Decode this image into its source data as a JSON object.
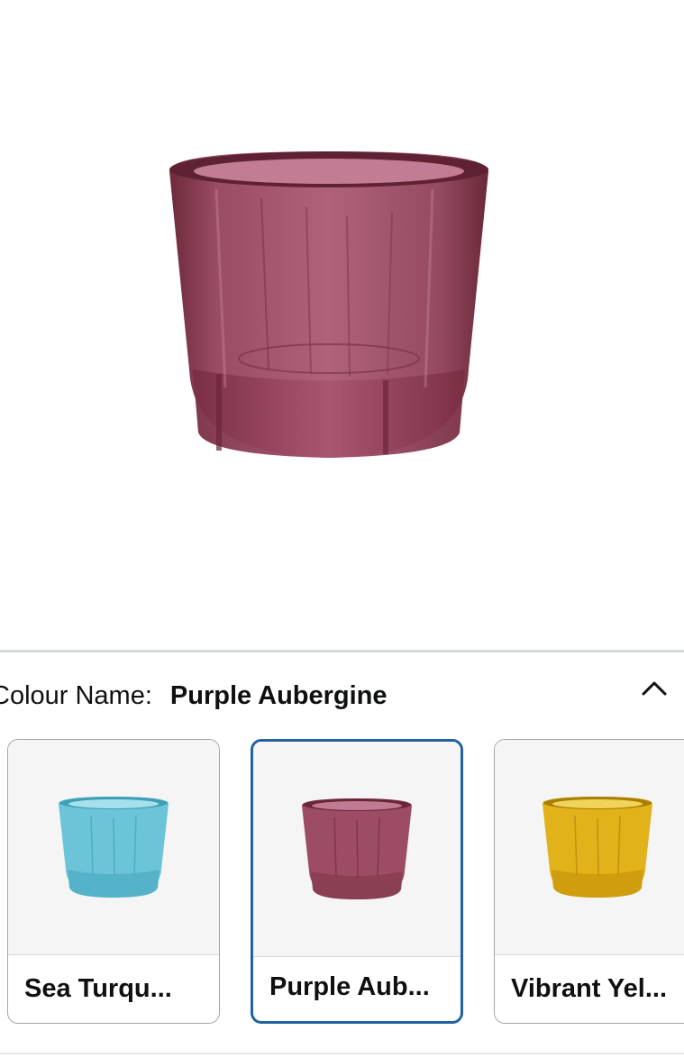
{
  "product": {
    "image_alt": "Purple Aubergine glass votive",
    "main_color": "#8a3f53"
  },
  "actions": {
    "wishlist_icon": "heart-icon",
    "share_icon": "share-icon"
  },
  "variation": {
    "label": "Colour Name:",
    "selected_value": "Purple Aubergine",
    "collapse_icon": "chevron-up-icon"
  },
  "swatches": [
    {
      "label": "Sea Turqu...",
      "color": "#6cc4d8",
      "selected": false
    },
    {
      "label": "Purple Aub...",
      "color": "#8a3f53",
      "selected": true
    },
    {
      "label": "Vibrant Yel...",
      "color": "#e1b21a",
      "selected": false
    }
  ],
  "colors": {
    "selected_border": "#2162a1",
    "divider": "#d5d9d9",
    "text": "#0f1111"
  }
}
